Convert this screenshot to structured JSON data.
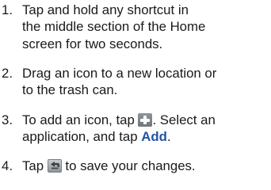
{
  "steps": [
    {
      "number": "1.",
      "lines": [
        "Tap and hold any shortcut in",
        "the middle section of the Home",
        "screen for two seconds."
      ]
    },
    {
      "number": "2.",
      "lines": [
        "Drag an icon to a new location or",
        "to the trash can."
      ]
    },
    {
      "number": "3.",
      "line1_before_icon": "To add an icon, tap",
      "icon": "add-plus-icon",
      "line1_after_icon": ". Select an",
      "line2_before_link": "application, and tap",
      "link_text": "Add",
      "line2_after_link": "."
    },
    {
      "number": "4.",
      "before_icon": "Tap",
      "icon": "save-back-arrow-icon",
      "after_icon": "to save your changes."
    }
  ],
  "colors": {
    "text": "#1a1a1a",
    "link": "#1f55a8",
    "icon_gray": "#7b8184"
  }
}
